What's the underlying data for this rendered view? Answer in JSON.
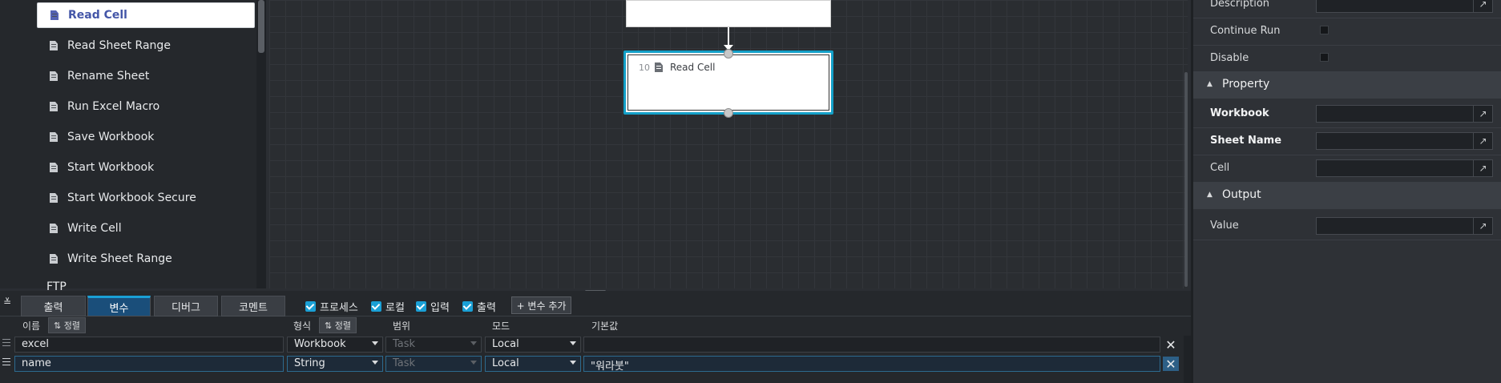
{
  "activity_list": {
    "items": [
      {
        "label": "Read Cell",
        "selected": true
      },
      {
        "label": "Read Sheet Range"
      },
      {
        "label": "Rename Sheet"
      },
      {
        "label": "Run Excel Macro"
      },
      {
        "label": "Save Workbook"
      },
      {
        "label": "Start Workbook"
      },
      {
        "label": "Start Workbook Secure"
      },
      {
        "label": "Write Cell"
      },
      {
        "label": "Write Sheet Range"
      }
    ],
    "next_group": "FTP"
  },
  "canvas": {
    "selected_node": {
      "number": "10",
      "title": "Read Cell",
      "icon": "excel-doc-icon"
    }
  },
  "properties": {
    "common": {
      "description_label": "Description",
      "continue_run_label": "Continue Run",
      "disable_label": "Disable"
    },
    "property_section": {
      "title": "Property",
      "workbook_label": "Workbook",
      "sheet_name_label": "Sheet Name",
      "cell_label": "Cell"
    },
    "output_section": {
      "title": "Output",
      "value_label": "Value"
    },
    "edit_icon": "↗"
  },
  "bottom": {
    "tabs": [
      "출력",
      "변수",
      "디버그",
      "코멘트"
    ],
    "active_tab": "변수",
    "filters": [
      "프로세스",
      "로컬",
      "입력",
      "출력"
    ],
    "add_variable_label": "+ 변수 추가",
    "columns": {
      "name": "이름",
      "sort": "⇅ 정렬",
      "type": "형식",
      "scope": "범위",
      "mode": "모드",
      "default": "기본값"
    },
    "variables": [
      {
        "name": "excel",
        "type": "Workbook",
        "scope": "Task",
        "mode": "Local",
        "default": ""
      },
      {
        "name": "name",
        "type": "String",
        "scope": "Task",
        "mode": "Local",
        "default": "\"워라붓\""
      }
    ],
    "delete_glyph": "✕"
  },
  "colors": {
    "accent": "#1aa0d6",
    "selected_node_border": "#14a0c8",
    "selected_item_text": "#4456a8"
  }
}
